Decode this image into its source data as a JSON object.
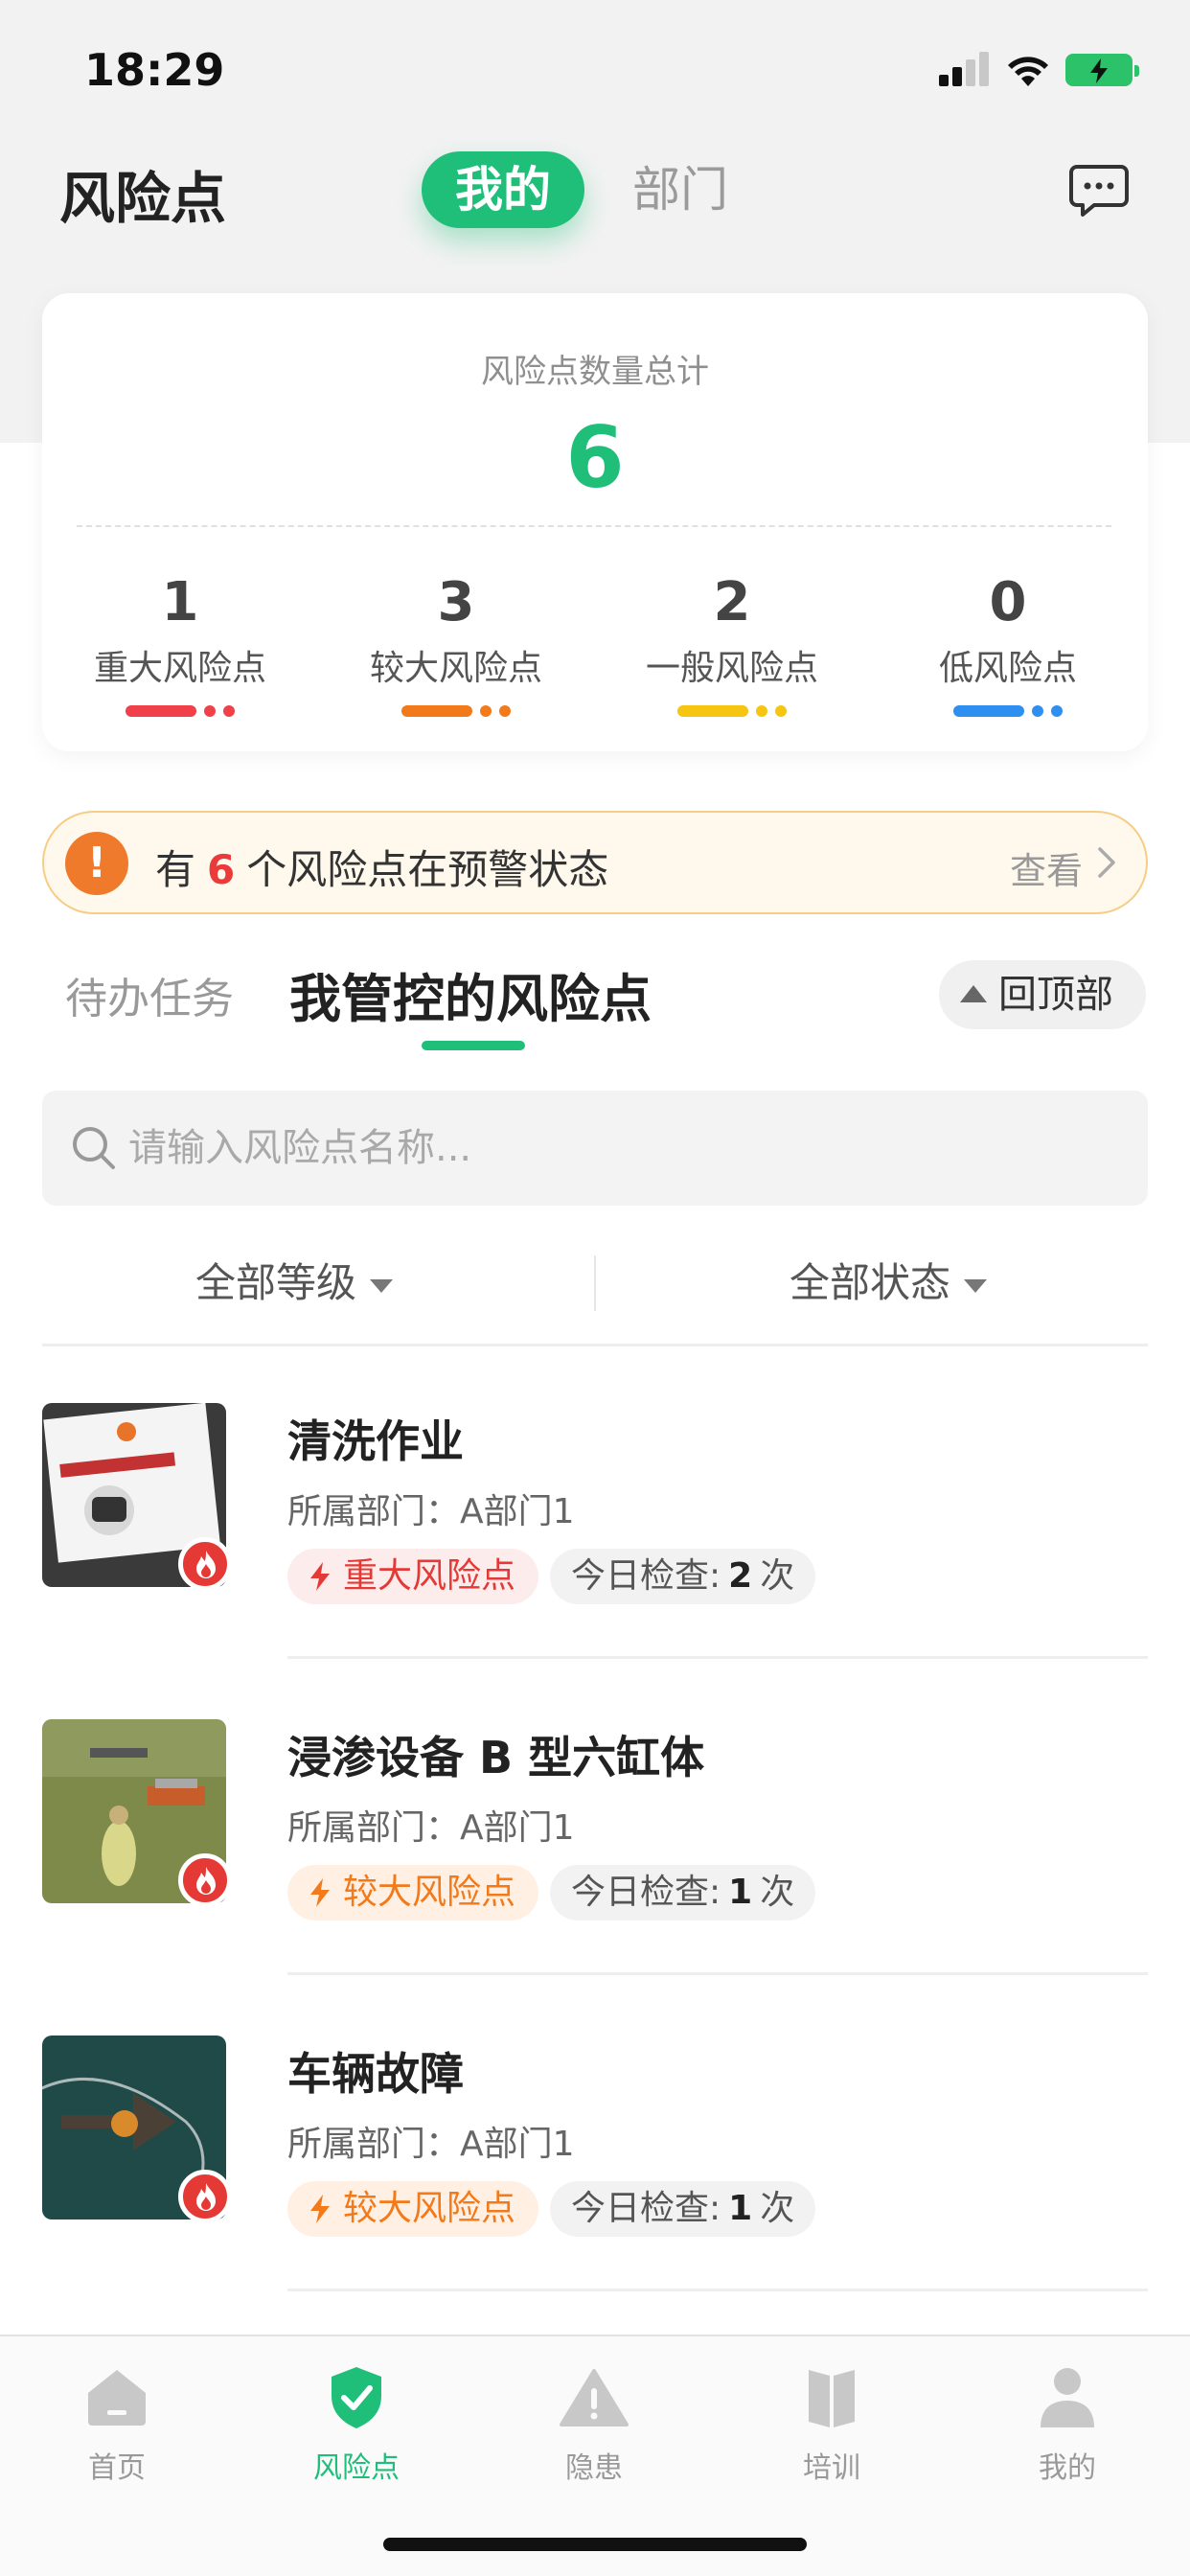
{
  "status_bar": {
    "time": "18:29"
  },
  "header": {
    "title": "风险点",
    "segments": {
      "mine": "我的",
      "dept": "部门"
    }
  },
  "summary": {
    "label": "风险点数量总计",
    "total": "6",
    "levels": [
      {
        "count": "1",
        "name": "重大风险点",
        "color": "#f0404a"
      },
      {
        "count": "3",
        "name": "较大风险点",
        "color": "#f27a1a"
      },
      {
        "count": "2",
        "name": "一般风险点",
        "color": "#f6c512"
      },
      {
        "count": "0",
        "name": "低风险点",
        "color": "#2f8ff0"
      }
    ]
  },
  "warning": {
    "icon": "!",
    "prefix": "有",
    "count": "6",
    "suffix": "个风险点在预警状态",
    "link": "查看"
  },
  "tabs": {
    "todo": "待办任务",
    "mine": "我管控的风险点",
    "to_top": "回顶部"
  },
  "search": {
    "placeholder": "请输入风险点名称..."
  },
  "filters": {
    "level": "全部等级",
    "status": "全部状态"
  },
  "items": [
    {
      "title": "清洗作业",
      "dept": "所属部门：A部门1",
      "level": "重大风险点",
      "check_prefix": "今日检查:",
      "check_count": "2",
      "check_suffix": "次",
      "thumb": "robot-box"
    },
    {
      "title": "浸渗设备 B 型六缸体",
      "dept": "所属部门：A部门1",
      "level": "较大风险点",
      "check_prefix": "今日检查:",
      "check_count": "1",
      "check_suffix": "次",
      "thumb": "game-field"
    },
    {
      "title": "车辆故障",
      "dept": "所属部门：A部门1",
      "level": "较大风险点",
      "check_prefix": "今日检查:",
      "check_count": "1",
      "check_suffix": "次",
      "thumb": "aerial-water"
    }
  ],
  "tabbar": [
    {
      "label": "首页",
      "icon": "home-icon"
    },
    {
      "label": "风险点",
      "icon": "shield-check-icon",
      "active": true
    },
    {
      "label": "隐患",
      "icon": "warning-icon"
    },
    {
      "label": "培训",
      "icon": "book-icon"
    },
    {
      "label": "我的",
      "icon": "person-icon"
    }
  ],
  "colors": {
    "accent": "#1fbf7a",
    "major": "#f0404a",
    "large": "#f27a1a",
    "warning_bg": "#fff8ec"
  }
}
